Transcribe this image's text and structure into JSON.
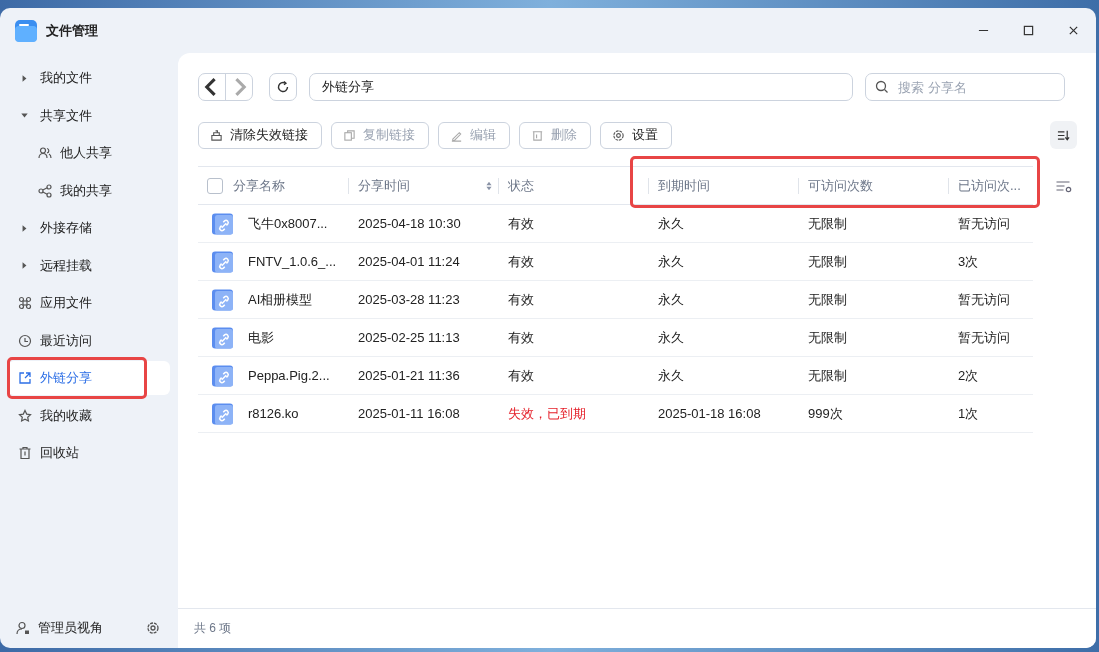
{
  "window": {
    "title": "文件管理"
  },
  "sidebar": {
    "items": [
      {
        "label": "我的文件",
        "kind": "tree",
        "expanded": false,
        "selected": false,
        "annotated": false
      },
      {
        "label": "共享文件",
        "kind": "tree",
        "expanded": true,
        "selected": false,
        "annotated": false,
        "children": [
          {
            "label": "他人共享",
            "selected": false
          },
          {
            "label": "我的共享",
            "selected": false
          }
        ]
      },
      {
        "label": "外接存储",
        "kind": "tree",
        "expanded": false,
        "selected": false,
        "annotated": false
      },
      {
        "label": "远程挂载",
        "kind": "tree",
        "expanded": false,
        "selected": false,
        "annotated": false
      },
      {
        "label": "应用文件",
        "kind": "link",
        "selected": false,
        "annotated": false
      },
      {
        "label": "最近访问",
        "kind": "link",
        "selected": false,
        "annotated": false
      },
      {
        "label": "外链分享",
        "kind": "link",
        "selected": true,
        "annotated": true
      },
      {
        "label": "我的收藏",
        "kind": "link",
        "selected": false,
        "annotated": false
      },
      {
        "label": "回收站",
        "kind": "link",
        "selected": false,
        "annotated": false
      }
    ],
    "footer": {
      "label": "管理员视角"
    }
  },
  "path": {
    "value": "外链分享"
  },
  "search": {
    "placeholder": "搜索 分享名"
  },
  "toolbar": [
    {
      "label": "清除失效链接",
      "disabled": false
    },
    {
      "label": "复制链接",
      "disabled": true
    },
    {
      "label": "编辑",
      "disabled": true
    },
    {
      "label": "删除",
      "disabled": true
    },
    {
      "label": "设置",
      "disabled": false
    }
  ],
  "table": {
    "select_all": {
      "checked": false
    },
    "columns": [
      {
        "label": "分享名称",
        "sortable": false,
        "highlighted": false
      },
      {
        "label": "分享时间",
        "sortable": true,
        "highlighted": false
      },
      {
        "label": "状态",
        "sortable": false,
        "highlighted": false
      },
      {
        "label": "到期时间",
        "sortable": false,
        "highlighted": true
      },
      {
        "label": "可访问次数",
        "sortable": false,
        "highlighted": true
      },
      {
        "label": "已访问次...",
        "sortable": false,
        "highlighted": true
      }
    ],
    "rows": [
      {
        "cells": [
          "飞牛0x8007...",
          "2025-04-18 10:30",
          "有效",
          "永久",
          "无限制",
          "暂无访问"
        ],
        "expired": false
      },
      {
        "cells": [
          "FNTV_1.0.6_...",
          "2025-04-01 11:24",
          "有效",
          "永久",
          "无限制",
          "3次"
        ],
        "expired": false
      },
      {
        "cells": [
          "AI相册模型",
          "2025-03-28 11:23",
          "有效",
          "永久",
          "无限制",
          "暂无访问"
        ],
        "expired": false
      },
      {
        "cells": [
          "电影",
          "2025-02-25 11:13",
          "有效",
          "永久",
          "无限制",
          "暂无访问"
        ],
        "expired": false
      },
      {
        "cells": [
          "Peppa.Pig.2...",
          "2025-01-21 11:36",
          "有效",
          "永久",
          "无限制",
          "2次"
        ],
        "expired": false
      },
      {
        "cells": [
          "r8126.ko",
          "2025-01-11 16:08",
          "失效，已到期",
          "2025-01-18 16:08",
          "999次",
          "1次"
        ],
        "expired": true
      }
    ]
  },
  "status_bar": {
    "count": "共 6 项"
  }
}
